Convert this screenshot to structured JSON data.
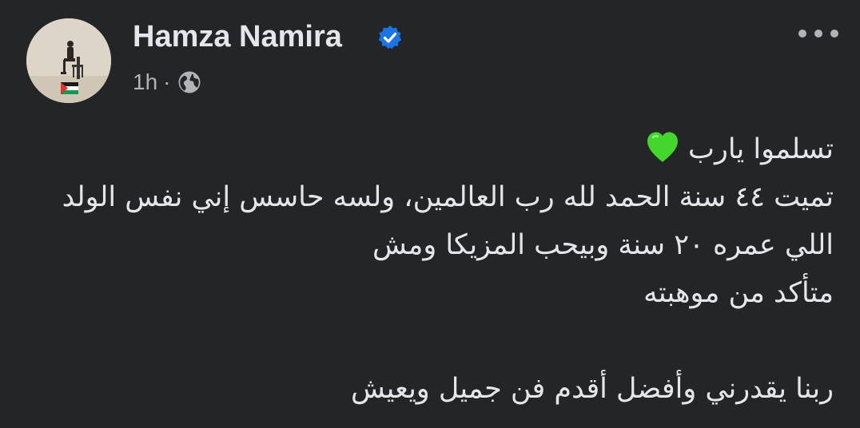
{
  "post": {
    "author": "Hamza Namira",
    "timestamp": "1h",
    "separator": "·",
    "audience_icon": "globe-icon",
    "verified_icon": "verified-badge-icon",
    "more_icon": "more-options-icon",
    "text": {
      "line1": "تسلموا يارب",
      "line1_emoji": "green-heart-icon",
      "line2": "تميت ٤٤ سنة الحمد لله رب العالمين، ولسه حاسس إني نفس الولد",
      "line3": "اللي عمره ٢٠ سنة وبيحب المزيكا ومش",
      "line4": "متأكد من موهبته",
      "line5": "ربنا يقدرني وأفضل أقدم فن جميل ويعيش"
    }
  },
  "colors": {
    "background": "#242526",
    "primary_text": "#e4e6eb",
    "secondary_text": "#b0b3b8",
    "verified_blue": "#1b74e4",
    "heart_green": "#44d62c"
  }
}
